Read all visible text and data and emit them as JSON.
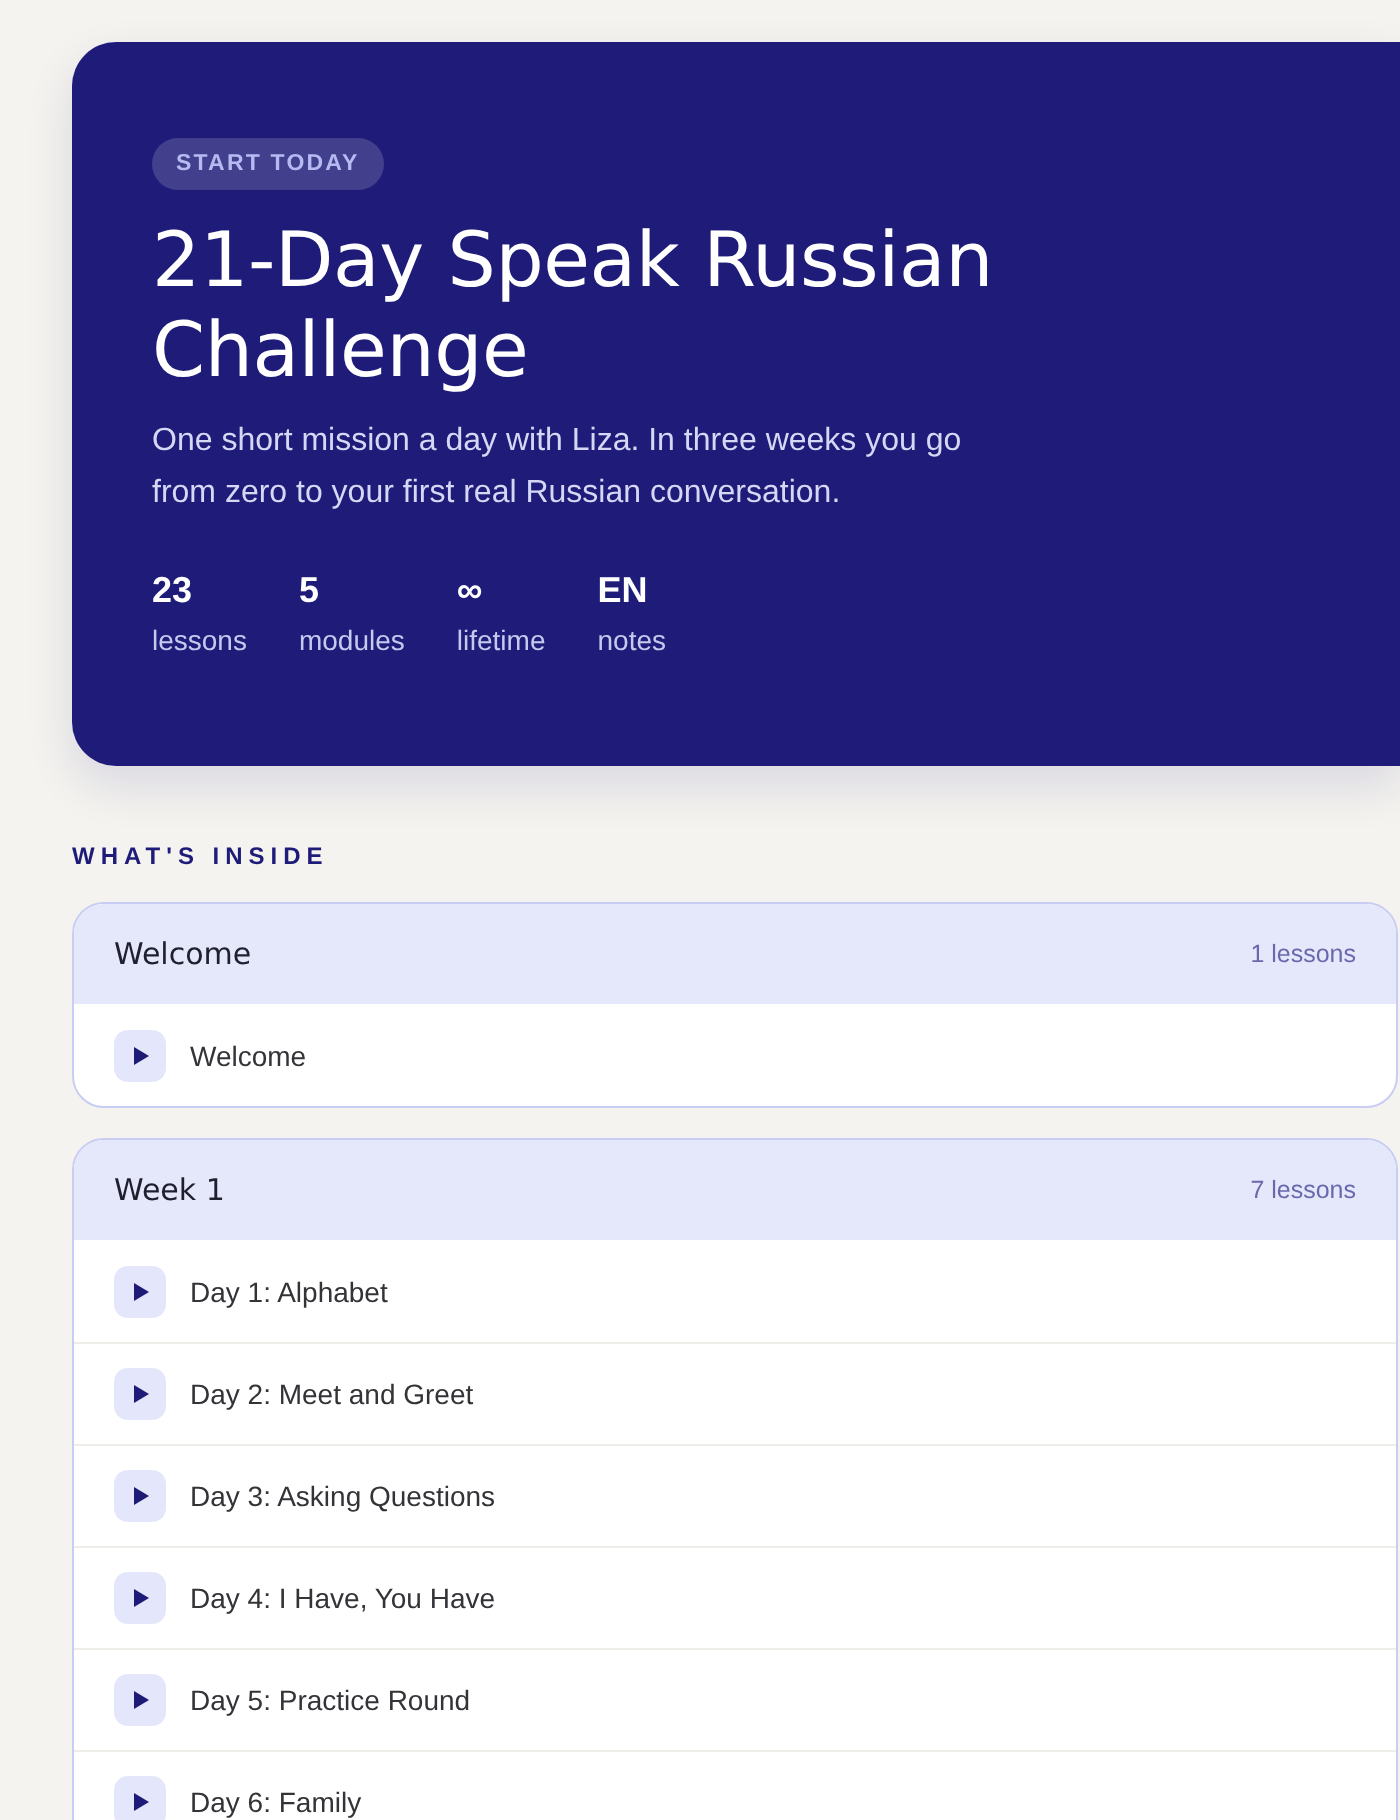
{
  "hero": {
    "badge": "START TODAY",
    "title": "21-Day Speak Russian Challenge",
    "description": "One short mission a day with Liza. In three weeks you go from zero to your first real Russian conversation.",
    "stats": [
      {
        "value": "23",
        "label": "lessons"
      },
      {
        "value": "5",
        "label": "modules"
      },
      {
        "value": "∞",
        "label": "lifetime"
      },
      {
        "value": "EN",
        "label": "notes"
      }
    ]
  },
  "section_title": "WHAT'S INSIDE",
  "modules": [
    {
      "title": "Welcome",
      "count": "1 lessons",
      "lessons": [
        "Welcome"
      ]
    },
    {
      "title": "Week 1",
      "count": "7 lessons",
      "lessons": [
        "Day 1: Alphabet",
        "Day 2: Meet and Greet",
        "Day 3: Asking Questions",
        "Day 4: I Have, You Have",
        "Day 5: Practice Round",
        "Day 6: Family"
      ]
    }
  ]
}
